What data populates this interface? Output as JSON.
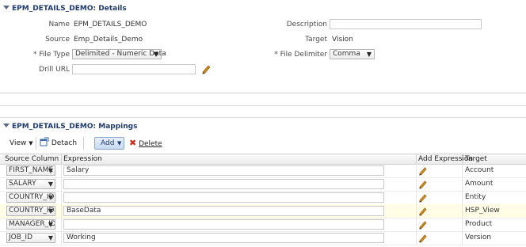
{
  "details": {
    "title": "EPM_DETAILS_DEMO: Details",
    "name_label": "Name",
    "name_value": "EPM_DETAILS_DEMO",
    "source_label": "Source",
    "source_value": "Emp_Details_Demo",
    "file_type_label": "* File Type",
    "file_type_value": "Delimited - Numeric Data",
    "drill_url_label": "Drill URL",
    "drill_url_value": "",
    "description_label": "Description",
    "description_value": "",
    "target_label": "Target",
    "target_value": "Vision",
    "file_delimiter_label": "* File Delimiter",
    "file_delimiter_value": "Comma"
  },
  "mappings": {
    "title": "EPM_DETAILS_DEMO: Mappings",
    "toolbar": {
      "view_label": "View",
      "detach_label": "Detach",
      "add_label": "Add",
      "delete_label": "Delete"
    },
    "columns": [
      "Source Column",
      "Expression",
      "Add Expression",
      "Target"
    ],
    "rows": [
      {
        "source": "FIRST_NAME",
        "expression": "Salary",
        "target": "Account"
      },
      {
        "source": "SALARY",
        "expression": "",
        "target": "Amount"
      },
      {
        "source": "COUNTRY_ID",
        "expression": "",
        "target": "Entity"
      },
      {
        "source": "COUNTRY_ID",
        "expression": "BaseData",
        "target": "HSP_View"
      },
      {
        "source": "MANAGER_ID",
        "expression": "",
        "target": "Product"
      },
      {
        "source": "JOB_ID",
        "expression": "Working",
        "target": "Version"
      }
    ]
  },
  "colors": {
    "title_text": "#1f3b6e",
    "highlight_row": "#fffde6",
    "delete_icon": "#cc2a1e",
    "pencil": "#d08a1a"
  }
}
